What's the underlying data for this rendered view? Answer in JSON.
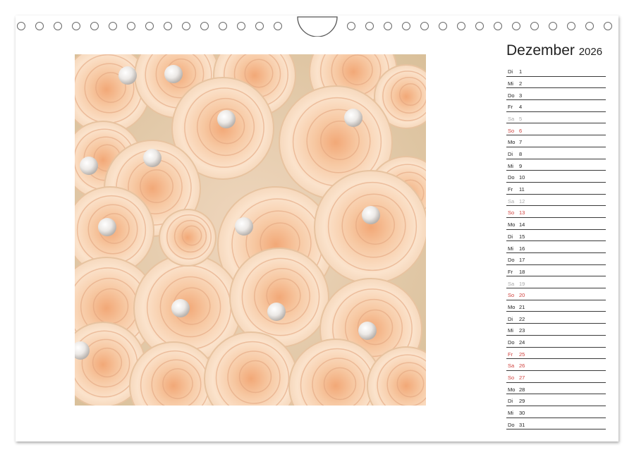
{
  "calendar": {
    "month": "Dezember",
    "year": "2026"
  },
  "photo": {
    "subject": "roses-with-pearls"
  },
  "colors": {
    "weekday": "#222222",
    "saturday": "#a9a9a9",
    "sunday_holiday": "#d0413d"
  },
  "days": [
    {
      "wd": "Di",
      "d": "1",
      "type": "weekday"
    },
    {
      "wd": "Mi",
      "d": "2",
      "type": "weekday"
    },
    {
      "wd": "Do",
      "d": "3",
      "type": "weekday"
    },
    {
      "wd": "Fr",
      "d": "4",
      "type": "weekday"
    },
    {
      "wd": "Sa",
      "d": "5",
      "type": "sat"
    },
    {
      "wd": "So",
      "d": "6",
      "type": "sun"
    },
    {
      "wd": "Mo",
      "d": "7",
      "type": "weekday"
    },
    {
      "wd": "Di",
      "d": "8",
      "type": "weekday"
    },
    {
      "wd": "Mi",
      "d": "9",
      "type": "weekday"
    },
    {
      "wd": "Do",
      "d": "10",
      "type": "weekday"
    },
    {
      "wd": "Fr",
      "d": "11",
      "type": "weekday"
    },
    {
      "wd": "Sa",
      "d": "12",
      "type": "sat"
    },
    {
      "wd": "So",
      "d": "13",
      "type": "sun"
    },
    {
      "wd": "Mo",
      "d": "14",
      "type": "weekday"
    },
    {
      "wd": "Di",
      "d": "15",
      "type": "weekday"
    },
    {
      "wd": "Mi",
      "d": "16",
      "type": "weekday"
    },
    {
      "wd": "Do",
      "d": "17",
      "type": "weekday"
    },
    {
      "wd": "Fr",
      "d": "18",
      "type": "weekday"
    },
    {
      "wd": "Sa",
      "d": "19",
      "type": "sat"
    },
    {
      "wd": "So",
      "d": "20",
      "type": "sun"
    },
    {
      "wd": "Mo",
      "d": "21",
      "type": "weekday"
    },
    {
      "wd": "Di",
      "d": "22",
      "type": "weekday"
    },
    {
      "wd": "Mi",
      "d": "23",
      "type": "weekday"
    },
    {
      "wd": "Do",
      "d": "24",
      "type": "weekday"
    },
    {
      "wd": "Fr",
      "d": "25",
      "type": "holiday"
    },
    {
      "wd": "Sa",
      "d": "26",
      "type": "holiday"
    },
    {
      "wd": "So",
      "d": "27",
      "type": "sun"
    },
    {
      "wd": "Mo",
      "d": "28",
      "type": "weekday"
    },
    {
      "wd": "Di",
      "d": "29",
      "type": "weekday"
    },
    {
      "wd": "Mi",
      "d": "30",
      "type": "weekday"
    },
    {
      "wd": "Do",
      "d": "31",
      "type": "weekday"
    }
  ]
}
